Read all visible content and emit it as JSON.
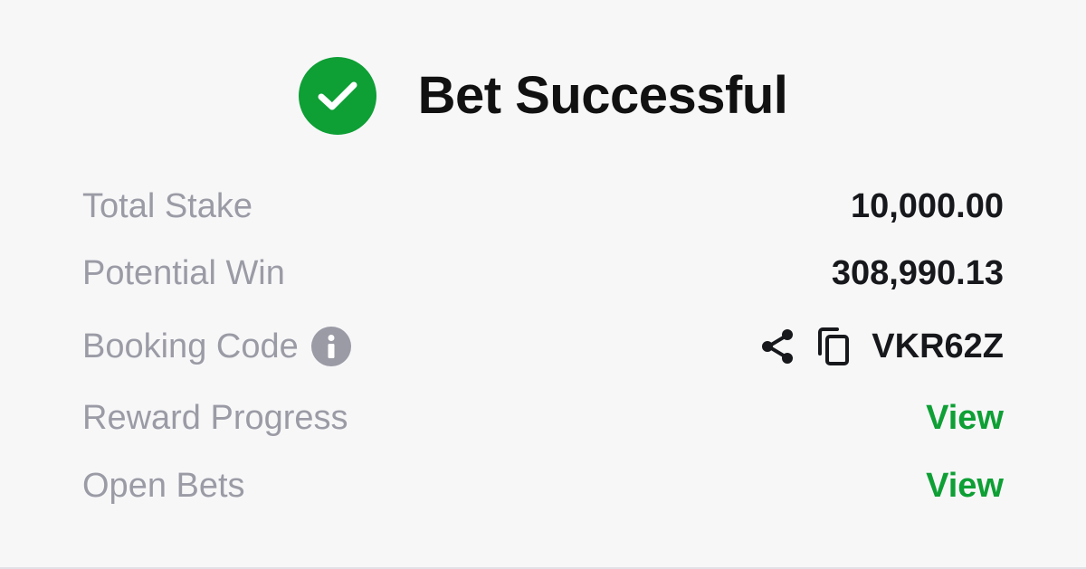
{
  "theme": {
    "success_color": "#0e9f35",
    "label_color": "#9a9ba5",
    "value_color": "#17181c"
  },
  "header": {
    "icon": "check-circle-icon",
    "title": "Bet Successful"
  },
  "details": {
    "total_stake": {
      "label": "Total Stake",
      "value": "10,000.00"
    },
    "potential_win": {
      "label": "Potential Win",
      "value": "308,990.13"
    },
    "booking_code": {
      "label": "Booking Code",
      "info_icon": "info-icon",
      "share_icon": "share-icon",
      "copy_icon": "copy-icon",
      "value": "VKR62Z"
    },
    "reward_progress": {
      "label": "Reward Progress",
      "link": "View"
    },
    "open_bets": {
      "label": "Open Bets",
      "link": "View"
    }
  }
}
